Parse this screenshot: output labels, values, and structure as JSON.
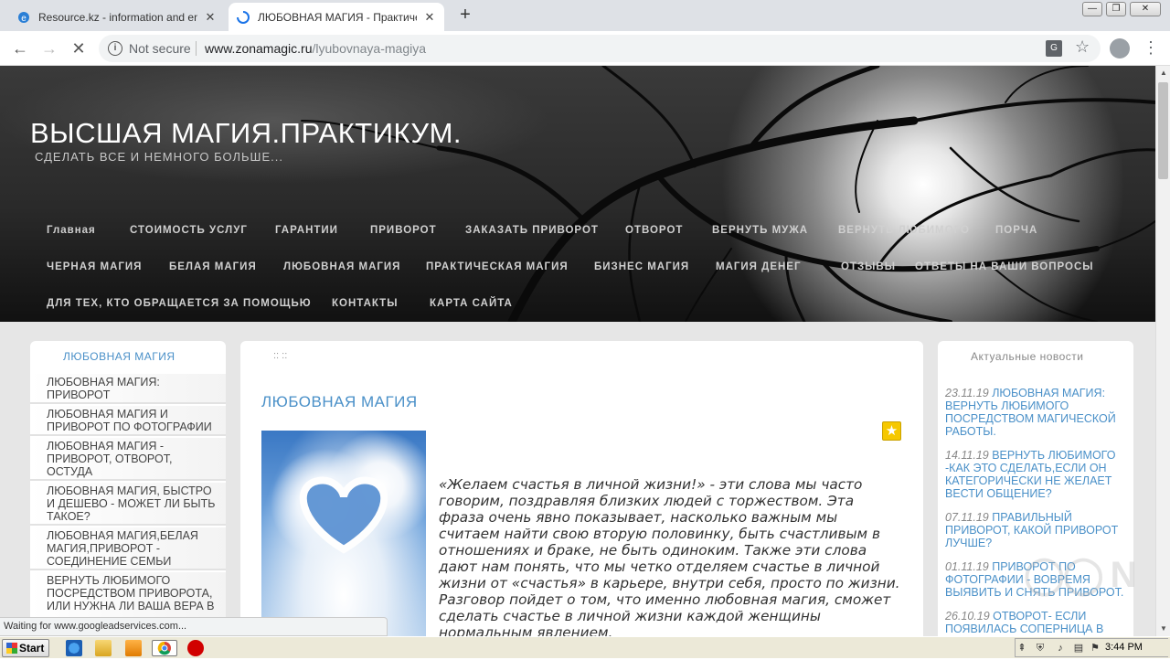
{
  "browser": {
    "tabs": [
      {
        "title": "Resource.kz - information and entert",
        "active": false
      },
      {
        "title": "ЛЮБОВНАЯ МАГИЯ - Практическая",
        "active": true
      }
    ],
    "new_tab": "+",
    "window_controls": {
      "minimize": "—",
      "maximize": "❐",
      "close": "✕"
    },
    "security_label": "Not secure",
    "url_host": "www.zonamagic.ru",
    "url_path": "/lyubovnaya-magiya",
    "status": "Waiting for www.googleadservices.com..."
  },
  "site": {
    "title": "ВЫСШАЯ МАГИЯ.ПРАКТИКУМ.",
    "subtitle": "СДЕЛАТЬ ВСЕ И НЕМНОГО БОЛЬШЕ...",
    "menu_rows": [
      [
        "Главная",
        "СТОИМОСТЬ УСЛУГ",
        "ГАРАНТИИ",
        "ПРИВОРОТ",
        "ЗАКАЗАТЬ ПРИВОРОТ",
        "ОТВОРОТ",
        "ВЕРНУТЬ МУЖА",
        "ВЕРНУТЬ ЛЮБИМОГО",
        "ПОРЧА"
      ],
      [
        "ЧЕРНАЯ МАГИЯ",
        "БЕЛАЯ МАГИЯ",
        "ЛЮБОВНАЯ МАГИЯ",
        "ПРАКТИЧЕСКАЯ МАГИЯ",
        "БИЗНЕС МАГИЯ",
        "МАГИЯ ДЕНЕГ",
        "ОТЗЫВЫ",
        "ОТВЕТЫ НА ВАШИ ВОПРОСЫ"
      ],
      [
        "ДЛЯ ТЕХ, КТО ОБРАЩАЕТСЯ ЗА ПОМОЩЬЮ",
        "КОНТАКТЫ",
        "КАРТА САЙТА"
      ]
    ]
  },
  "left_sidebar": {
    "heading": "ЛЮБОВНАЯ МАГИЯ",
    "items": [
      "ЛЮБОВНАЯ МАГИЯ: ПРИВОРОТ",
      "ЛЮБОВНАЯ МАГИЯ И ПРИВОРОТ ПО ФОТОГРАФИИ",
      "ЛЮБОВНАЯ МАГИЯ - ПРИВОРОТ, ОТВОРОТ, ОСТУДА",
      "ЛЮБОВНАЯ МАГИЯ, БЫСТРО И ДЕШЕВО - МОЖЕТ ЛИ БЫТЬ ТАКОЕ?",
      "ЛЮБОВНАЯ МАГИЯ,БЕЛАЯ МАГИЯ,ПРИВОРОТ - СОЕДИНЕНИЕ СЕМЬИ",
      "ВЕРНУТЬ ЛЮБИМОГО ПОСРЕДСТВОМ ПРИВОРОТА, ИЛИ НУЖНА ЛИ ВАША ВЕРА В"
    ]
  },
  "content": {
    "breadcrumb": ":: ::",
    "title": "ЛЮБОВНАЯ МАГИЯ",
    "body": "«Желаем счастья в личной жизни!» - эти слова мы часто говорим, поздравляя близких людей с торжеством. Эта фраза очень явно показывает, насколько важным мы считаем найти свою вторую половинку, быть счастливым в отношениях и браке, не быть одиноким. Также эти слова дают нам понять, что мы четко отделяем счастье в личной жизни от «счастья» в карьере, внутри себя, просто по жизни. Разговор пойдет о том, что именно любовная магия, сможет сделать счастье в личной жизни каждой женщины нормальным явлением."
  },
  "right_sidebar": {
    "heading": "Актуальные новости",
    "news": [
      {
        "date": "23.11.19",
        "title": "ЛЮБОВНАЯ МАГИЯ: ВЕРНУТЬ ЛЮБИМОГО ПОСРЕДСТВОМ МАГИЧЕСКОЙ РАБОТЫ."
      },
      {
        "date": "14.11.19",
        "title": "ВЕРНУТЬ ЛЮБИМОГО -КАК ЭТО СДЕЛАТЬ,ЕСЛИ ОН КАТЕГОРИЧЕСКИ НЕ ЖЕЛАЕТ ВЕСТИ ОБЩЕНИЕ?"
      },
      {
        "date": "07.11.19",
        "title": "ПРАВИЛЬНЫЙ ПРИВОРОТ, КАКОЙ ПРИВОРОТ ЛУЧШЕ?"
      },
      {
        "date": "01.11.19",
        "title": "ПРИВОРОТ ПО ФОТОГРАФИИ - ВОВРЕМЯ ВЫЯВИТЬ И СНЯТЬ ПРИВОРОТ."
      },
      {
        "date": "26.10.19",
        "title": "ОТВОРОТ- ЕСЛИ ПОЯВИЛАСЬ СОПЕРНИЦА В"
      }
    ]
  },
  "taskbar": {
    "start_label": "Start",
    "clock": "3:44 PM"
  },
  "colors": {
    "accent": "#4a90c8",
    "menu_text": "#d0d0d0",
    "star": "#f6c800"
  }
}
